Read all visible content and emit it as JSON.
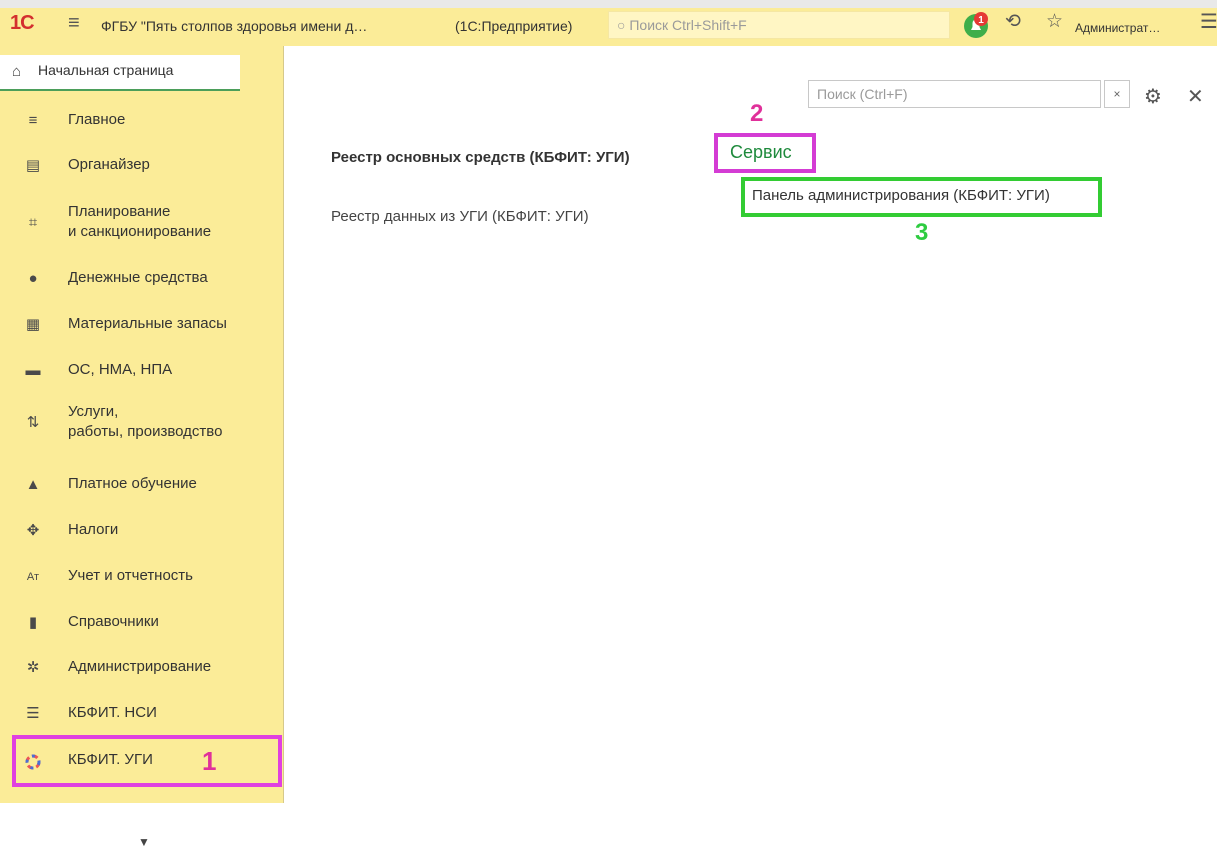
{
  "topbar": {
    "logo": "1С",
    "title": "ФГБУ \"Пять столпов здоровья имени д…",
    "mode": "(1С:Предприятие)",
    "search_placeholder": "Поиск Ctrl+Shift+F",
    "notification_count": "1",
    "user": "Администрат…"
  },
  "sidebar": {
    "home": "Начальная страница",
    "items": [
      {
        "label": "Главное",
        "icon": "menu-icon"
      },
      {
        "label": "Органайзер",
        "icon": "organizer-icon"
      },
      {
        "label": "Планирование\nи санкционирование",
        "icon": "planning-icon"
      },
      {
        "label": "Денежные средства",
        "icon": "money-icon"
      },
      {
        "label": "Материальные запасы",
        "icon": "inventory-icon"
      },
      {
        "label": "ОС, НМА, НПА",
        "icon": "truck-icon"
      },
      {
        "label": "Услуги,\nработы, производство",
        "icon": "services-icon"
      },
      {
        "label": "Платное обучение",
        "icon": "graduation-icon"
      },
      {
        "label": "Налоги",
        "icon": "emblem-icon"
      },
      {
        "label": "Учет и отчетность",
        "icon": "accounting-icon"
      },
      {
        "label": "Справочники",
        "icon": "books-icon"
      },
      {
        "label": "Администрирование",
        "icon": "gear-icon"
      },
      {
        "label": "КБФИТ. НСИ",
        "icon": "database-icon"
      },
      {
        "label": "КБФИТ. УГИ",
        "icon": "kbfit-icon"
      }
    ]
  },
  "content": {
    "search_placeholder": "Поиск (Ctrl+F)",
    "clear": "×",
    "registry_main": "Реестр основных средств (КБФИТ: УГИ)",
    "registry_data": "Реестр данных из УГИ (КБФИТ: УГИ)",
    "service": "Сервис",
    "admin_panel": "Панель администрирования (КБФИТ: УГИ)"
  },
  "annotations": {
    "step1": "1",
    "step2": "2",
    "step3": "3",
    "colors": {
      "magenta": "#e040e0",
      "green": "#33cc33",
      "panel_bg": "#fbec98"
    }
  }
}
